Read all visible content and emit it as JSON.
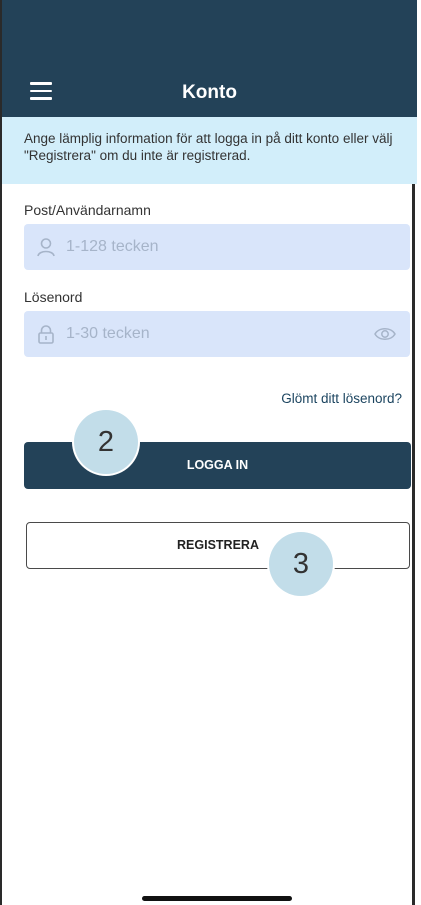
{
  "header": {
    "title": "Konto",
    "menu_icon": "hamburger-menu-icon",
    "background": "#234258"
  },
  "info": {
    "text": "Ange lämplig information för att logga in på ditt konto eller välj \"Registrera\" om du inte är registrerad.",
    "background": "#d2eefa"
  },
  "username": {
    "label": "Post/Användarnamn",
    "placeholder": "1-128 tecken",
    "icon": "user-icon"
  },
  "password": {
    "label": "Lösenord",
    "placeholder": "1-30 tecken",
    "icon": "lock-icon",
    "toggle_icon": "eye-icon"
  },
  "forgot_link": "Glömt ditt lösenord?",
  "login_button": "LOGGA IN",
  "register_button": "REGISTRERA",
  "step_markers": [
    "2",
    "3"
  ]
}
